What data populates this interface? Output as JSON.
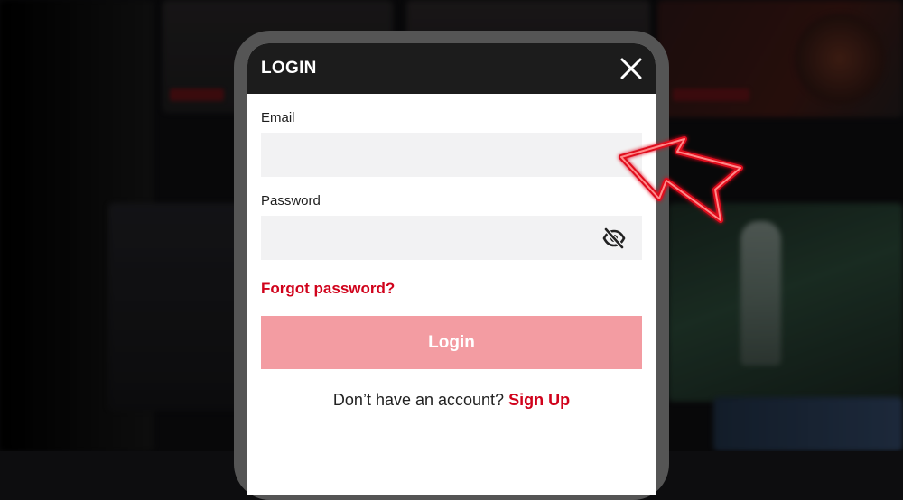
{
  "modal": {
    "title": "LOGIN"
  },
  "form": {
    "email_label": "Email",
    "email_value": "",
    "email_placeholder": "",
    "password_label": "Password",
    "password_value": "",
    "password_placeholder": "",
    "forgot_label": "Forgot password?",
    "login_label": "Login"
  },
  "footer": {
    "prompt": "Don’t have an account?",
    "signup_label": "Sign Up"
  },
  "icons": {
    "close": "close-icon",
    "eye": "eye-slash-icon",
    "pointer": "arrow-pointer-icon"
  },
  "colors": {
    "brand_red": "#d0021b",
    "login_button": "#f39ca2",
    "header_bg": "#1c1c1c",
    "input_bg": "#f2f2f3"
  }
}
